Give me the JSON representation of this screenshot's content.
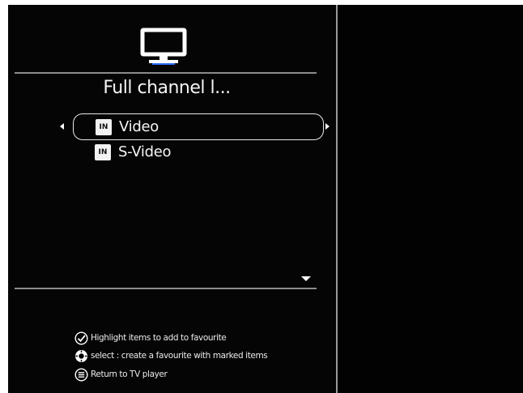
{
  "list": {
    "title": "Full channel l...",
    "items": [
      {
        "badge": "IN",
        "label": "Video",
        "selected": true
      },
      {
        "badge": "IN",
        "label": "S-Video",
        "selected": false
      }
    ]
  },
  "hints": [
    {
      "icon": "check-circle-icon",
      "text": "Highlight items to add to favourite"
    },
    {
      "icon": "ok-button-icon",
      "text": "select : create a favourite with marked items"
    },
    {
      "icon": "menu-button-icon",
      "text": "Return to TV player"
    }
  ]
}
